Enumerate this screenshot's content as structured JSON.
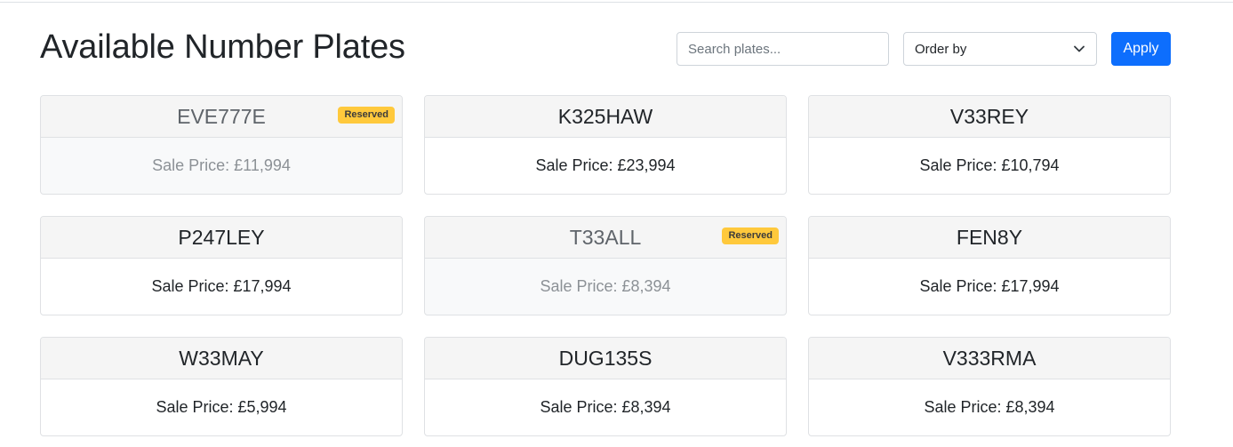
{
  "header": {
    "title": "Available Number Plates",
    "search_placeholder": "Search plates...",
    "order_by_label": "Order by",
    "order_icon": "chevron-down-icon",
    "apply_label": "Apply"
  },
  "colors": {
    "primary": "#0d6efd",
    "badge": "#ffc93c"
  },
  "plates": [
    {
      "plate": "EVE777E",
      "price": "Sale Price: £11,994",
      "reserved": true,
      "badge": "Reserved"
    },
    {
      "plate": "K325HAW",
      "price": "Sale Price: £23,994",
      "reserved": false,
      "badge": ""
    },
    {
      "plate": "V33REY",
      "price": "Sale Price: £10,794",
      "reserved": false,
      "badge": ""
    },
    {
      "plate": "P247LEY",
      "price": "Sale Price: £17,994",
      "reserved": false,
      "badge": ""
    },
    {
      "plate": "T33ALL",
      "price": "Sale Price: £8,394",
      "reserved": true,
      "badge": "Reserved"
    },
    {
      "plate": "FEN8Y",
      "price": "Sale Price: £17,994",
      "reserved": false,
      "badge": ""
    },
    {
      "plate": "W33MAY",
      "price": "Sale Price: £5,994",
      "reserved": false,
      "badge": ""
    },
    {
      "plate": "DUG135S",
      "price": "Sale Price: £8,394",
      "reserved": false,
      "badge": ""
    },
    {
      "plate": "V333RMA",
      "price": "Sale Price: £8,394",
      "reserved": false,
      "badge": ""
    }
  ]
}
